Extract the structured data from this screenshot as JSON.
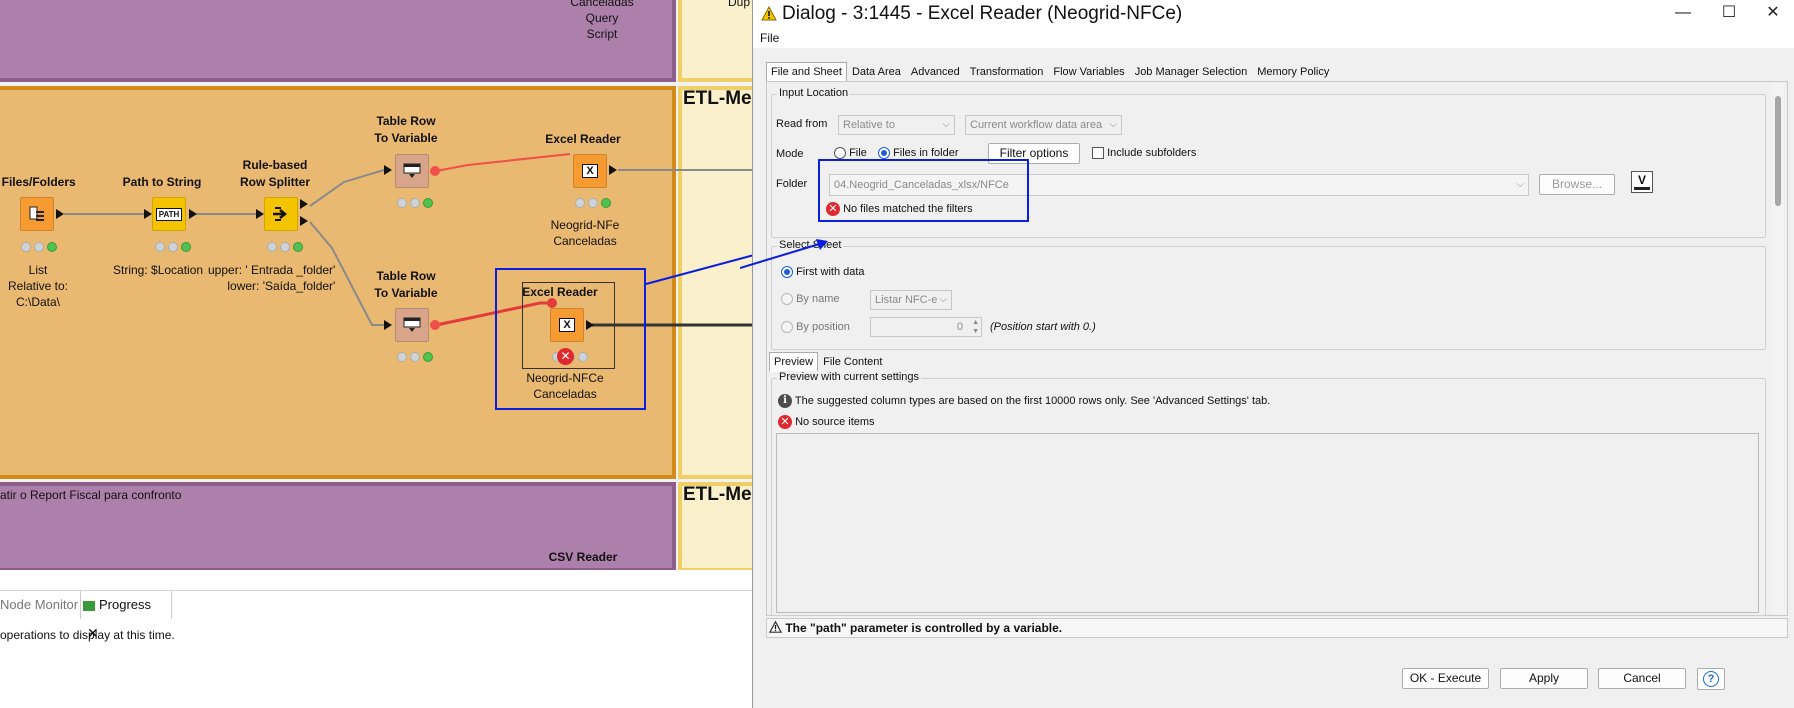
{
  "workflow": {
    "annotations": {
      "etl_title_1": "ETL-Me",
      "etl_title_2": "ETL-Me",
      "bottom_text": "atir o Report Fiscal para confronto",
      "top_label_1": "Canceladas",
      "top_label_2": "Query",
      "top_label_3": "Script",
      "top_label_dup": "Dup"
    },
    "nodes": {
      "list_files": {
        "title": "t Files/Folders",
        "label_1": "List",
        "label_2": "Relative to:",
        "label_3": "C:\\Data\\"
      },
      "path_to_string": {
        "title": "Path to String",
        "label": "String: $Location"
      },
      "row_splitter": {
        "title_1": "Rule-based",
        "title_2": "Row Splitter",
        "label_1": "upper: ' Entrada _folder'",
        "label_2": "lower: 'Saída_folder'"
      },
      "table_row_var_1": {
        "title_1": "Table Row",
        "title_2": "To Variable"
      },
      "table_row_var_2": {
        "title_1": "Table Row",
        "title_2": "To Variable"
      },
      "excel_reader_1": {
        "title": "Excel Reader",
        "label_1": "Neogrid-NFe",
        "label_2": "Canceladas"
      },
      "excel_reader_2": {
        "title": "Excel Reader",
        "label_1": "Neogrid-NFCe",
        "label_2": "Canceladas"
      },
      "csv_reader": {
        "title": "CSV Reader"
      }
    },
    "icons": {
      "path_icon_text": "PATH",
      "excel_icon_text": "X"
    }
  },
  "monitor": {
    "tab_node_monitor": "Node Monitor",
    "tab_progress": "Progress",
    "message": "operations to display at this time."
  },
  "dialog": {
    "title": "Dialog - 3:1445 - Excel Reader (Neogrid-NFCe)",
    "menu_file": "File",
    "tabs": [
      "File and Sheet",
      "Data Area",
      "Advanced",
      "Transformation",
      "Flow Variables",
      "Job Manager Selection",
      "Memory Policy"
    ],
    "input_location": {
      "legend": "Input Location",
      "read_from_label": "Read from",
      "read_from_value": "Relative to",
      "read_from_target": "Current workflow data area",
      "mode_label": "Mode",
      "mode_file": "File",
      "mode_files_in_folder": "Files in folder",
      "filter_options": "Filter options",
      "include_subfolders": "Include subfolders",
      "folder_label": "Folder",
      "folder_value": "04.Neogrid_Canceladas_xlsx/NFCe",
      "browse": "Browse...",
      "error": "No files matched the filters",
      "var_icon_text": "V"
    },
    "select_sheet": {
      "legend": "Select Sheet",
      "first_with_data": "First with data",
      "by_name": "By name",
      "by_name_value": "Listar NFC-e",
      "by_position": "By position",
      "position_value": "0",
      "position_hint": "(Position start with 0.)"
    },
    "preview": {
      "tabs": [
        "Preview",
        "File Content"
      ],
      "legend": "Preview with current settings",
      "info_message": "The suggested column types are based on the first 10000 rows only. See 'Advanced Settings' tab.",
      "error_message": "No source items"
    },
    "warning": "The \"path\" parameter is controlled by a variable.",
    "buttons": {
      "ok_execute": "OK - Execute",
      "apply": "Apply",
      "cancel": "Cancel",
      "help": "?"
    }
  },
  "colors": {
    "highlight_blue": "#0a1ee0",
    "annotation_orange": "#e9b871",
    "annotation_purple": "#ad80ab",
    "annotation_cream": "#fbf0cc",
    "error_red": "#e0282f"
  }
}
